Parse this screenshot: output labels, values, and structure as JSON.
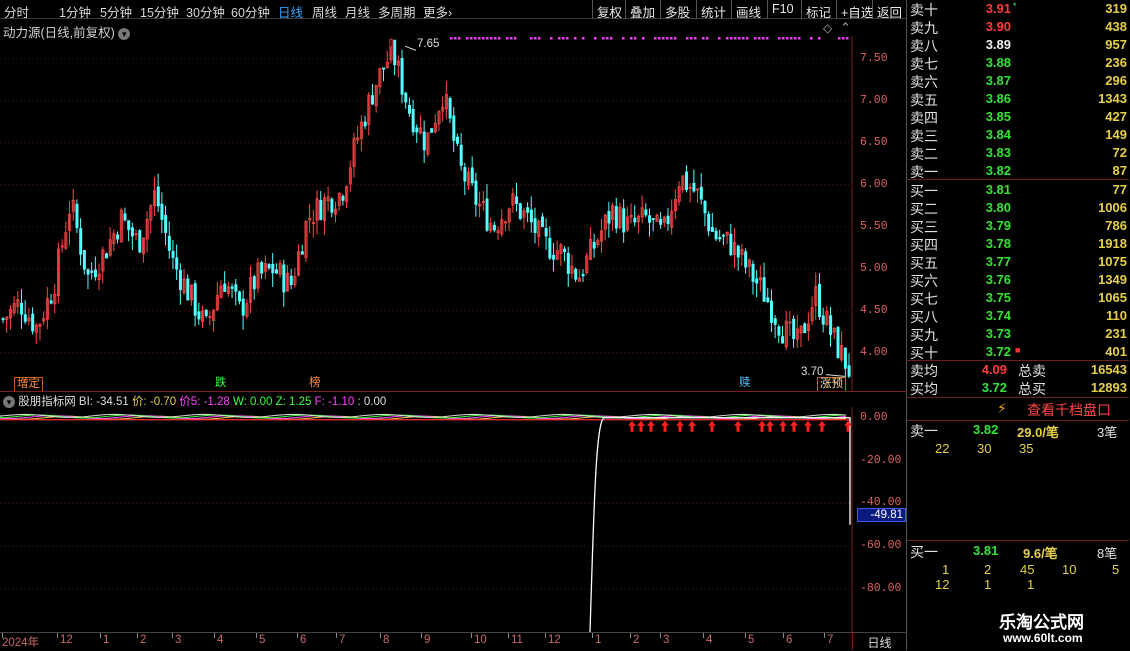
{
  "toolbar": {
    "periods": [
      "分时",
      "1分钟",
      "5分钟",
      "15分钟",
      "30分钟",
      "60分钟",
      "日线",
      "周线",
      "月线",
      "多周期"
    ],
    "more_label": "更多",
    "selected": "日线",
    "right_buttons": [
      "复权",
      "叠加",
      "多股",
      "统计",
      "画线",
      "F10",
      "标记",
      "+自选",
      "返回"
    ]
  },
  "main_chart": {
    "title": "动力源(日线,前复权)",
    "price_ticks": [
      "7.50",
      "7.00",
      "6.50",
      "6.00",
      "5.50",
      "5.00",
      "4.50",
      "4.00"
    ],
    "high_label": "7.65",
    "low_label": "3.70",
    "tags": [
      "增定",
      "跌",
      "榜",
      "赎",
      "涨预"
    ]
  },
  "chart_data": {
    "type": "candlestick",
    "title": "动力源(日线,前复权)",
    "ylim": [
      3.7,
      7.7
    ],
    "x_labels": [
      "2024年",
      "12",
      "1",
      "2",
      "3",
      "4",
      "5",
      "6",
      "7",
      "8",
      "9",
      "10",
      "11",
      "12",
      "1",
      "2",
      "3",
      "4",
      "5",
      "6",
      "7"
    ],
    "high": 7.65,
    "low": 3.7,
    "close_points": [
      4.4,
      4.6,
      4.3,
      4.8,
      5.8,
      4.9,
      5.2,
      5.6,
      5.3,
      5.9,
      5.1,
      4.7,
      4.3,
      4.9,
      4.5,
      4.9,
      5.0,
      4.8,
      5.6,
      5.8,
      5.9,
      6.6,
      7.2,
      7.6,
      6.9,
      6.5,
      7.1,
      6.2,
      5.8,
      5.5,
      5.8,
      5.6,
      5.3,
      5.2,
      4.9,
      5.3,
      5.7,
      5.5,
      5.6,
      5.4,
      6.1,
      5.9,
      5.4,
      5.3,
      5.0,
      4.7,
      4.3,
      4.1,
      4.7,
      4.2,
      3.8
    ],
    "indicator": {
      "name": "股朋指标网",
      "ylim": [
        -100,
        5
      ],
      "ticks": [
        "0.00",
        "-20.00",
        "-40.00",
        "-60.00",
        "-80.00"
      ],
      "current_value": "-49.81",
      "values": {
        "BI": "-34.51",
        "价": "-0.70",
        "价5": "-1.28",
        "W": "0.00",
        "Z": "1.25",
        "F": "-1.10",
        "extra": "0.00"
      }
    }
  },
  "indicator_title": {
    "name": "股朋指标网",
    "bi": "BI: -34.51",
    "jia": "价: -0.70",
    "jia5": "价5: -1.28",
    "w": "W: 0.00",
    "z": "Z: 1.25",
    "f": "F: -1.10",
    "last": ": 0.00"
  },
  "date_axis": [
    "2024年",
    "12",
    "1",
    "2",
    "3",
    "4",
    "5",
    "6",
    "7",
    "8",
    "9",
    "10",
    "11",
    "12",
    "1",
    "2",
    "3",
    "4",
    "5",
    "6",
    "7"
  ],
  "period_label": "日线",
  "orderbook": {
    "asks": [
      {
        "name": "卖十",
        "price": "3.91",
        "vol": "319"
      },
      {
        "name": "卖九",
        "price": "3.90",
        "vol": "438"
      },
      {
        "name": "卖八",
        "price": "3.89",
        "vol": "957"
      },
      {
        "name": "卖七",
        "price": "3.88",
        "vol": "236"
      },
      {
        "name": "卖六",
        "price": "3.87",
        "vol": "296"
      },
      {
        "name": "卖五",
        "price": "3.86",
        "vol": "1343"
      },
      {
        "name": "卖四",
        "price": "3.85",
        "vol": "427"
      },
      {
        "name": "卖三",
        "price": "3.84",
        "vol": "149"
      },
      {
        "name": "卖二",
        "price": "3.83",
        "vol": "72"
      },
      {
        "name": "卖一",
        "price": "3.82",
        "vol": "87"
      }
    ],
    "bids": [
      {
        "name": "买一",
        "price": "3.81",
        "vol": "77"
      },
      {
        "name": "买二",
        "price": "3.80",
        "vol": "1006"
      },
      {
        "name": "买三",
        "price": "3.79",
        "vol": "786"
      },
      {
        "name": "买四",
        "price": "3.78",
        "vol": "1918"
      },
      {
        "name": "买五",
        "price": "3.77",
        "vol": "1075"
      },
      {
        "name": "买六",
        "price": "3.76",
        "vol": "1349"
      },
      {
        "name": "买七",
        "price": "3.75",
        "vol": "1065"
      },
      {
        "name": "买八",
        "price": "3.74",
        "vol": "110"
      },
      {
        "name": "买九",
        "price": "3.73",
        "vol": "231"
      },
      {
        "name": "买十",
        "price": "3.72",
        "vol": "401"
      }
    ],
    "avg_sell_label": "卖均",
    "avg_sell": "4.09",
    "total_sell_label": "总卖",
    "total_sell": "16543",
    "avg_buy_label": "买均",
    "avg_buy": "3.72",
    "total_buy_label": "总买",
    "total_buy": "12893"
  },
  "thousand": {
    "button": "查看千档盘口",
    "sell1": {
      "name": "卖一",
      "price": "3.82",
      "avg": "29.0/笔",
      "count": "3笔",
      "orders": [
        "22",
        "30",
        "35"
      ]
    },
    "buy1": {
      "name": "买一",
      "price": "3.81",
      "avg": "9.6/笔",
      "count": "8笔",
      "orders": [
        "1",
        "2",
        "45",
        "10",
        "5",
        "12",
        "1",
        "1"
      ]
    }
  },
  "watermark": {
    "name": "乐淘公式网",
    "url": "www.60lt.com"
  },
  "colors": {
    "up": "#ff4646",
    "down": "#54ffff",
    "ask_accent": "#ff3c3c",
    "bid_accent": "#34e334",
    "volume": "#e6d04a",
    "selected": "#35a7ff"
  }
}
